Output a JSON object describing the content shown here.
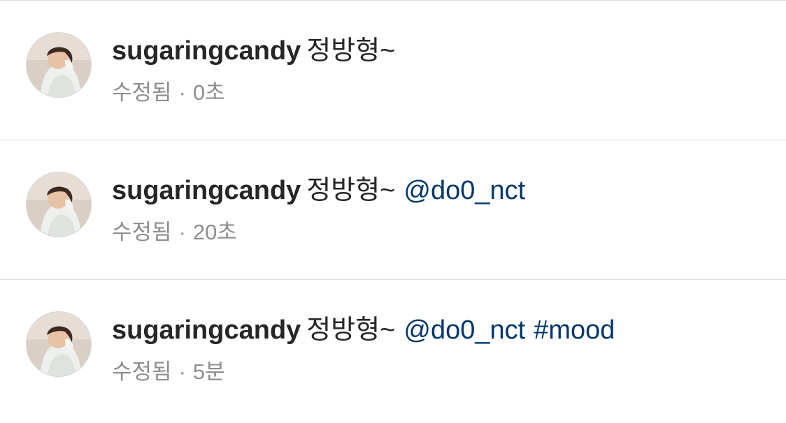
{
  "comments": [
    {
      "username": "sugaringcandy",
      "text": "정방형~",
      "mention": "",
      "hashtag": "",
      "edited_label": "수정됨",
      "separator": "·",
      "time": "0초"
    },
    {
      "username": "sugaringcandy",
      "text": "정방형~",
      "mention": "@do0_nct",
      "hashtag": "",
      "edited_label": "수정됨",
      "separator": "·",
      "time": "20초"
    },
    {
      "username": "sugaringcandy",
      "text": "정방형~",
      "mention": "@do0_nct",
      "hashtag": "#mood",
      "edited_label": "수정됨",
      "separator": "·",
      "time": "5분"
    }
  ],
  "colors": {
    "text": "#262626",
    "meta": "#8e8e8e",
    "link": "#00376b",
    "divider": "#dbdbdb"
  },
  "icons": {
    "avatar": "profile-photo"
  }
}
